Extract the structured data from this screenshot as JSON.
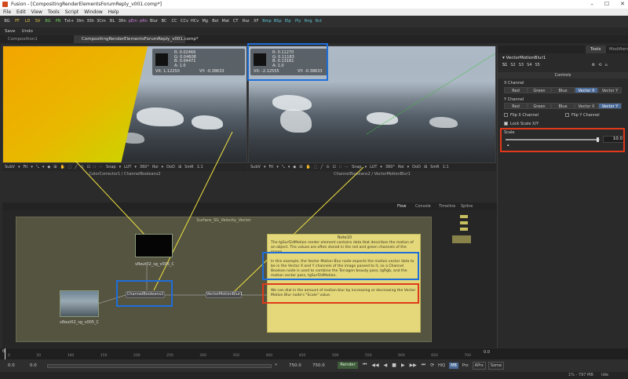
{
  "window": {
    "title": "Fusion - [CompositingRenderElementsForumReply_v001.comp*]",
    "controls": [
      "–",
      "☐",
      "✕"
    ]
  },
  "menu": [
    "File",
    "Edit",
    "View",
    "Tools",
    "Script",
    "Window",
    "Help"
  ],
  "toolbar": [
    "BG",
    "FF",
    "LD",
    "SV",
    "BG",
    "PN",
    "Txt+",
    "3Im",
    "3Sh",
    "3Cm",
    "3IL",
    "3Rn",
    "pEm",
    "pRn",
    "Blur",
    "BC",
    "CC",
    "CCv",
    "HCv",
    "Mg",
    "Bol",
    "Mat",
    "CT",
    "Rsz",
    "XF",
    "Bmp",
    "BSp",
    "Elp",
    "Ply",
    "Rng",
    "Rct"
  ],
  "file_strip": {
    "save": "Save",
    "undo": "Undo"
  },
  "tabs": [
    {
      "label": "Composition1",
      "active": false
    },
    {
      "label": "CompositingRenderElementsForumReply_v001.comp*",
      "active": true
    }
  ],
  "viewer_left": {
    "readout": {
      "r": "R: 0.02466",
      "g": "G: 0.04608",
      "b": "B: 0.04471",
      "a": "A: 1.0",
      "vx": "VX: 1.12250",
      "vy": "VY: -0.38633"
    },
    "tools": [
      "SubV",
      "▾",
      "Fit",
      "▾",
      "⤡",
      "▾",
      "◆",
      "⊞",
      "✋",
      "⬚",
      "╱",
      "⊙",
      "⊡",
      "∷",
      "⋯",
      "Snap",
      "▾",
      "LUT",
      "▾",
      "360°",
      "Roi",
      "▾",
      "DoD",
      "⊞",
      "SmR",
      "1:1"
    ],
    "status": "ColorCorrector1 / ChannelBooleans2"
  },
  "viewer_right": {
    "readout": {
      "r": "R: 0.11270",
      "g": "G: 0.11183",
      "b": "B: 0.13181",
      "a": "A: 1.0",
      "vx": "VX: -2.12555",
      "vy": "VY: -0.38633"
    },
    "tools": [
      "SubV",
      "▾",
      "Fit",
      "▾",
      "⤡",
      "▾",
      "◆",
      "⊞",
      "✋",
      "⬚",
      "╱",
      "⊙",
      "⊡",
      "∷",
      "⋯",
      "Snap",
      "▾",
      "LUT",
      "▾",
      "360°",
      "Roi",
      "▾",
      "DoD",
      "⊞",
      "SmR",
      "1:1"
    ],
    "status": "ChannelBooleans2 / VectorMotionBlur1"
  },
  "right_panel": {
    "tabs": [
      "Tools",
      "Modifiers"
    ],
    "tool_name": "VectorMotionBlur1",
    "slots": [
      "S1",
      "S2",
      "S3",
      "S4",
      "S5"
    ],
    "section": "Controls",
    "x_channel": {
      "label": "X Channel",
      "options": [
        "Red",
        "Green",
        "Blue",
        "Vector X",
        "Vector Y"
      ],
      "selected": "Vector X"
    },
    "y_channel": {
      "label": "Y Channel",
      "options": [
        "Red",
        "Green",
        "Blue",
        "Vector X",
        "Vector Y"
      ],
      "selected": "Vector Y"
    },
    "flip_x": "Flip X Channel",
    "flip_y": "Flip Y Channel",
    "lock_scale": "Lock Scale X/Y",
    "scale": {
      "label": "Scale",
      "value": "10.0",
      "fraction": 0.98
    }
  },
  "node_panel": {
    "tabs": [
      "Flow",
      "Console",
      "Timeline",
      "Spline"
    ],
    "underlay_label": "Surface_SG_Velocity_Vector",
    "nodes": {
      "top_thumb_label": "vRout02_sg_v005_C",
      "bottom_thumb_label": "vRout02_sg_v005_C",
      "channel_booleans": "ChannelBooleans2",
      "vector_motion_blur": "VectorMotionBlur1"
    },
    "note": {
      "title": "Note10",
      "p1": "The tgSurf2dMotion render element contains data that describes the motion of an object.  The values are often stored in the red and green channels of the image.",
      "p2": "In this example, the Vector Motion Blur node expects the motion vector data to be in the Vector X and Y  channels of the image passed to it, so a Channel Boolean node is used to combine the Terragen beauty pass, tgRgb, and the motion vector pass, tgSurf2dMotion.",
      "p3": "We can dial in the amount of motion blur by increasing or decreasing the Vector Motion Blur node's \"Scale\" value."
    }
  },
  "timeline": {
    "start": "0",
    "end": "0.0",
    "ruler": [
      "0",
      "50",
      "100",
      "150",
      "200",
      "250",
      "300",
      "350",
      "400",
      "450",
      "500",
      "550",
      "600",
      "650",
      "700"
    ]
  },
  "transport": {
    "global_start": "0.0",
    "render_start": "0.0",
    "render_end": "750.0",
    "global_end": "750.0",
    "render": "Render",
    "buttons": [
      "⏮",
      "◀◀",
      "◀",
      "■",
      "▶",
      "▶▶",
      "⏭",
      "⟳"
    ],
    "toggles": [
      "HiQ",
      "MB",
      "Prx",
      "APrx",
      "Some"
    ]
  },
  "status": {
    "mem": "1% - 797 MB",
    "state": "Idle"
  }
}
